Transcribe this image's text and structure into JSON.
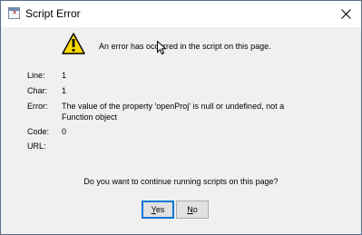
{
  "window": {
    "title": "Script Error"
  },
  "dialog": {
    "headline": "An error has occurred in the script on this page.",
    "fields": [
      {
        "label": "Line:",
        "value": "1"
      },
      {
        "label": "Char:",
        "value": "1"
      },
      {
        "label": "Error:",
        "value": "The value of the property 'openProj' is null or undefined, not a",
        "value_line2": "Function object"
      },
      {
        "label": "Code:",
        "value": "0"
      },
      {
        "label": "URL:",
        "value": ""
      }
    ],
    "question": "Do you want to continue running scripts on this page?",
    "buttons": {
      "yes": {
        "mnemonic": "Y",
        "rest": "es",
        "label": "Yes"
      },
      "no": {
        "mnemonic": "N",
        "rest": "o",
        "label": "No"
      }
    }
  },
  "icons": {
    "title": "script-error-window-icon",
    "warning": "warning-triangle-icon",
    "close": "close-icon",
    "cursor": "mouse-pointer-icon"
  },
  "colors": {
    "warning_fill": "#ffd800",
    "client_bg": "#f0f0f0",
    "default_button_border": "#0078d7"
  }
}
